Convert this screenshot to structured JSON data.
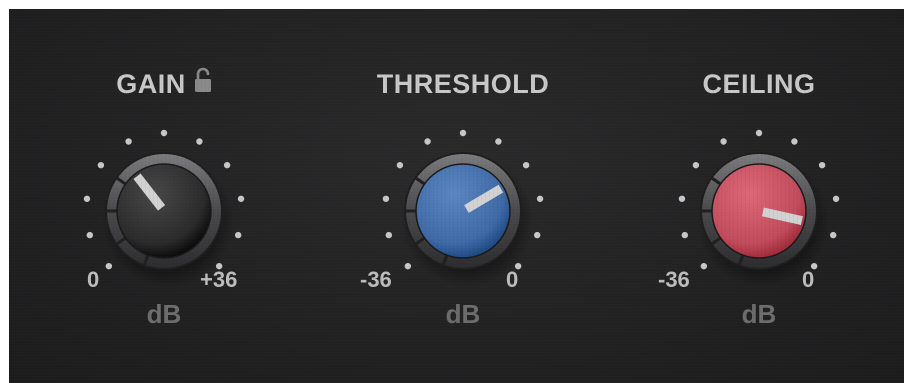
{
  "knobs": [
    {
      "id": "gain",
      "title": "GAIN",
      "has_lock": true,
      "lock_icon": "unlocked-padlock-icon",
      "min_label": "0",
      "max_label": "+36",
      "unit": "dB",
      "value_fraction": 0.36,
      "cap_color": "#2b2b2c"
    },
    {
      "id": "threshold",
      "title": "THRESHOLD",
      "has_lock": false,
      "min_label": "-36",
      "max_label": "0",
      "unit": "dB",
      "value_fraction": 0.72,
      "cap_color": "#3f6aa6"
    },
    {
      "id": "ceiling",
      "title": "CEILING",
      "has_lock": false,
      "min_label": "-36",
      "max_label": "0",
      "unit": "dB",
      "value_fraction": 0.88,
      "cap_color": "#c04c5c"
    }
  ]
}
